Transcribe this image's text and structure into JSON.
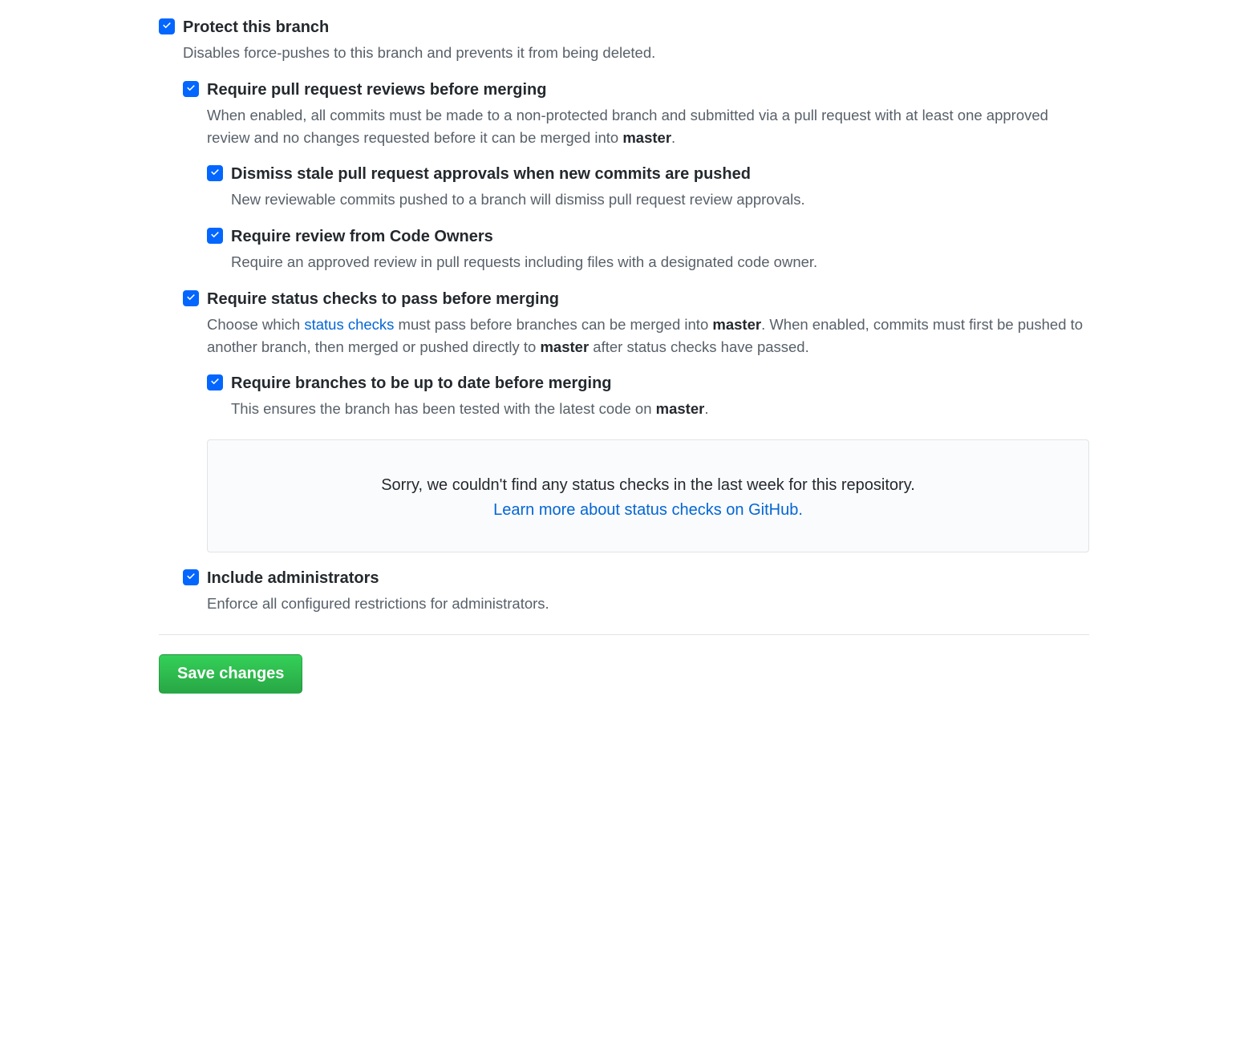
{
  "protect": {
    "title": "Protect this branch",
    "desc": "Disables force-pushes to this branch and prevents it from being deleted."
  },
  "reviews": {
    "title": "Require pull request reviews before merging",
    "desc_pre": "When enabled, all commits must be made to a non-protected branch and submitted via a pull request with at least one approved review and no changes requested before it can be merged into ",
    "branch": "master",
    "desc_post": "."
  },
  "dismiss": {
    "title": "Dismiss stale pull request approvals when new commits are pushed",
    "desc": "New reviewable commits pushed to a branch will dismiss pull request review approvals."
  },
  "codeowners": {
    "title": "Require review from Code Owners",
    "desc": "Require an approved review in pull requests including files with a designated code owner."
  },
  "status": {
    "title": "Require status checks to pass before merging",
    "desc_pre": "Choose which ",
    "link": "status checks",
    "desc_mid1": " must pass before branches can be merged into ",
    "branch1": "master",
    "desc_mid2": ". When enabled, commits must first be pushed to another branch, then merged or pushed directly to ",
    "branch2": "master",
    "desc_post": " after status checks have passed."
  },
  "uptodate": {
    "title": "Require branches to be up to date before merging",
    "desc_pre": "This ensures the branch has been tested with the latest code on ",
    "branch": "master",
    "desc_post": "."
  },
  "status_box": {
    "text": "Sorry, we couldn't find any status checks in the last week for this repository.",
    "link": "Learn more about status checks on GitHub."
  },
  "admins": {
    "title": "Include administrators",
    "desc": "Enforce all configured restrictions for administrators."
  },
  "save_button": "Save changes"
}
